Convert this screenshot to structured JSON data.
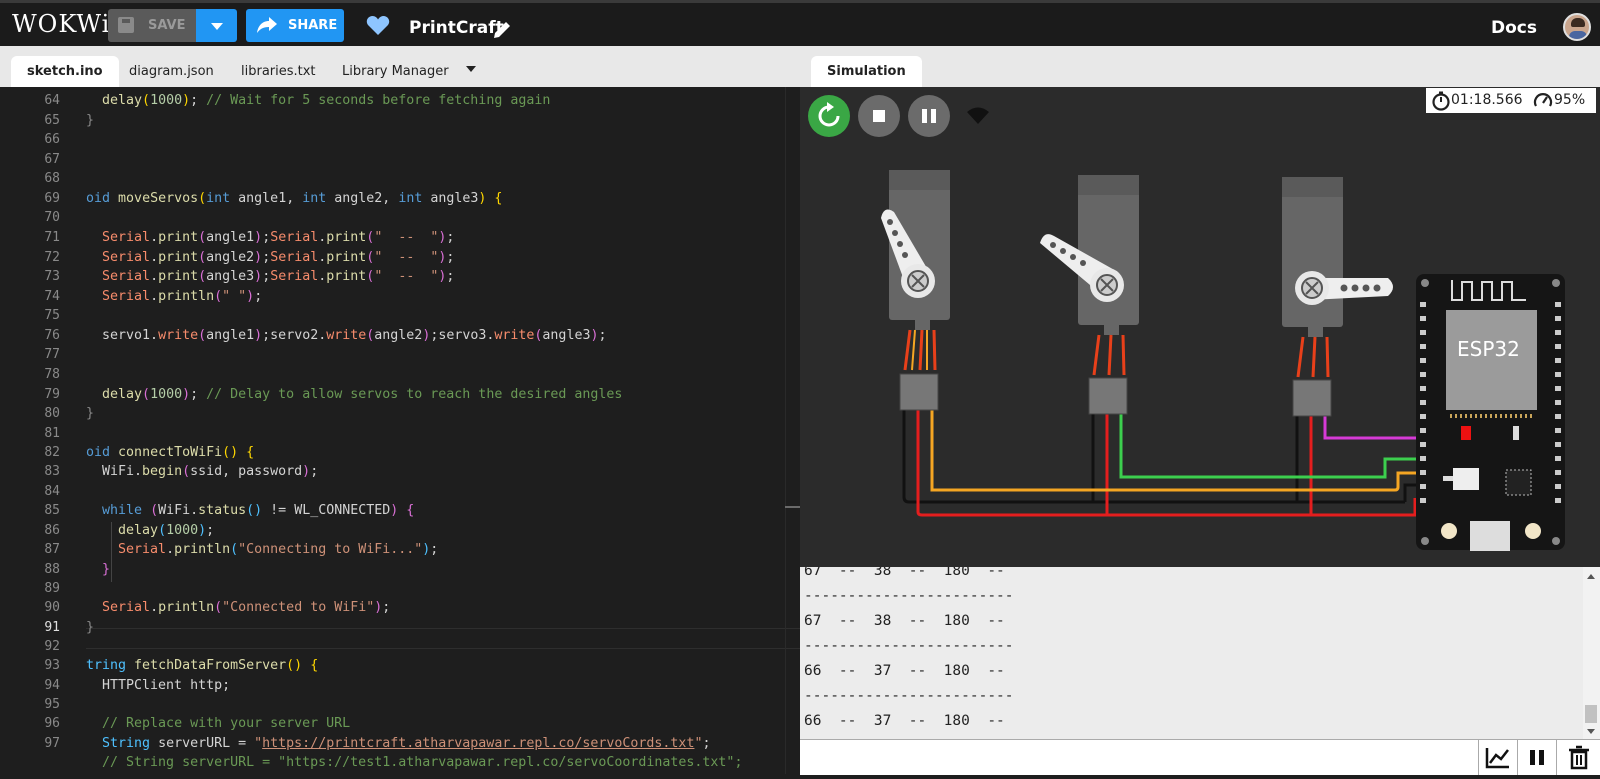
{
  "app": {
    "logo": "WOKWi",
    "save_label": "SAVE",
    "share_label": "SHARE",
    "project_name": "PrintCraft",
    "docs_label": "Docs"
  },
  "editor_tabs": [
    "sketch.ino",
    "diagram.json",
    "libraries.txt",
    "Library Manager"
  ],
  "sim_tab": "Simulation",
  "sim": {
    "elapsed_time": "01:18.566",
    "speed": "95%",
    "board_label": "ESP32"
  },
  "code": {
    "line_numbers": [
      "64",
      "65",
      "66",
      "67",
      "68",
      "69",
      "70",
      "71",
      "72",
      "73",
      "74",
      "75",
      "76",
      "77",
      "78",
      "79",
      "80",
      "81",
      "82",
      "83",
      "84",
      "85",
      "86",
      "87",
      "88",
      "89",
      "90",
      "91",
      "92",
      "93",
      "94",
      "95",
      "96",
      "97"
    ],
    "current_line": "91"
  },
  "serial": {
    "lines": [
      "67  --  38  --  180  --",
      "------------------------",
      "67  --  38  --  180  --",
      "------------------------",
      "66  --  37  --  180  --",
      "------------------------",
      "66  --  37  --  180  --"
    ]
  },
  "colors": {
    "accent": "#2196f3",
    "keyword": "#569cd6",
    "type": "#4fc1ff",
    "serial": "#f78c6c",
    "number": "#b5cea8",
    "string": "#ce9178",
    "comment": "#6a9955",
    "bracket": "#ffd700"
  }
}
